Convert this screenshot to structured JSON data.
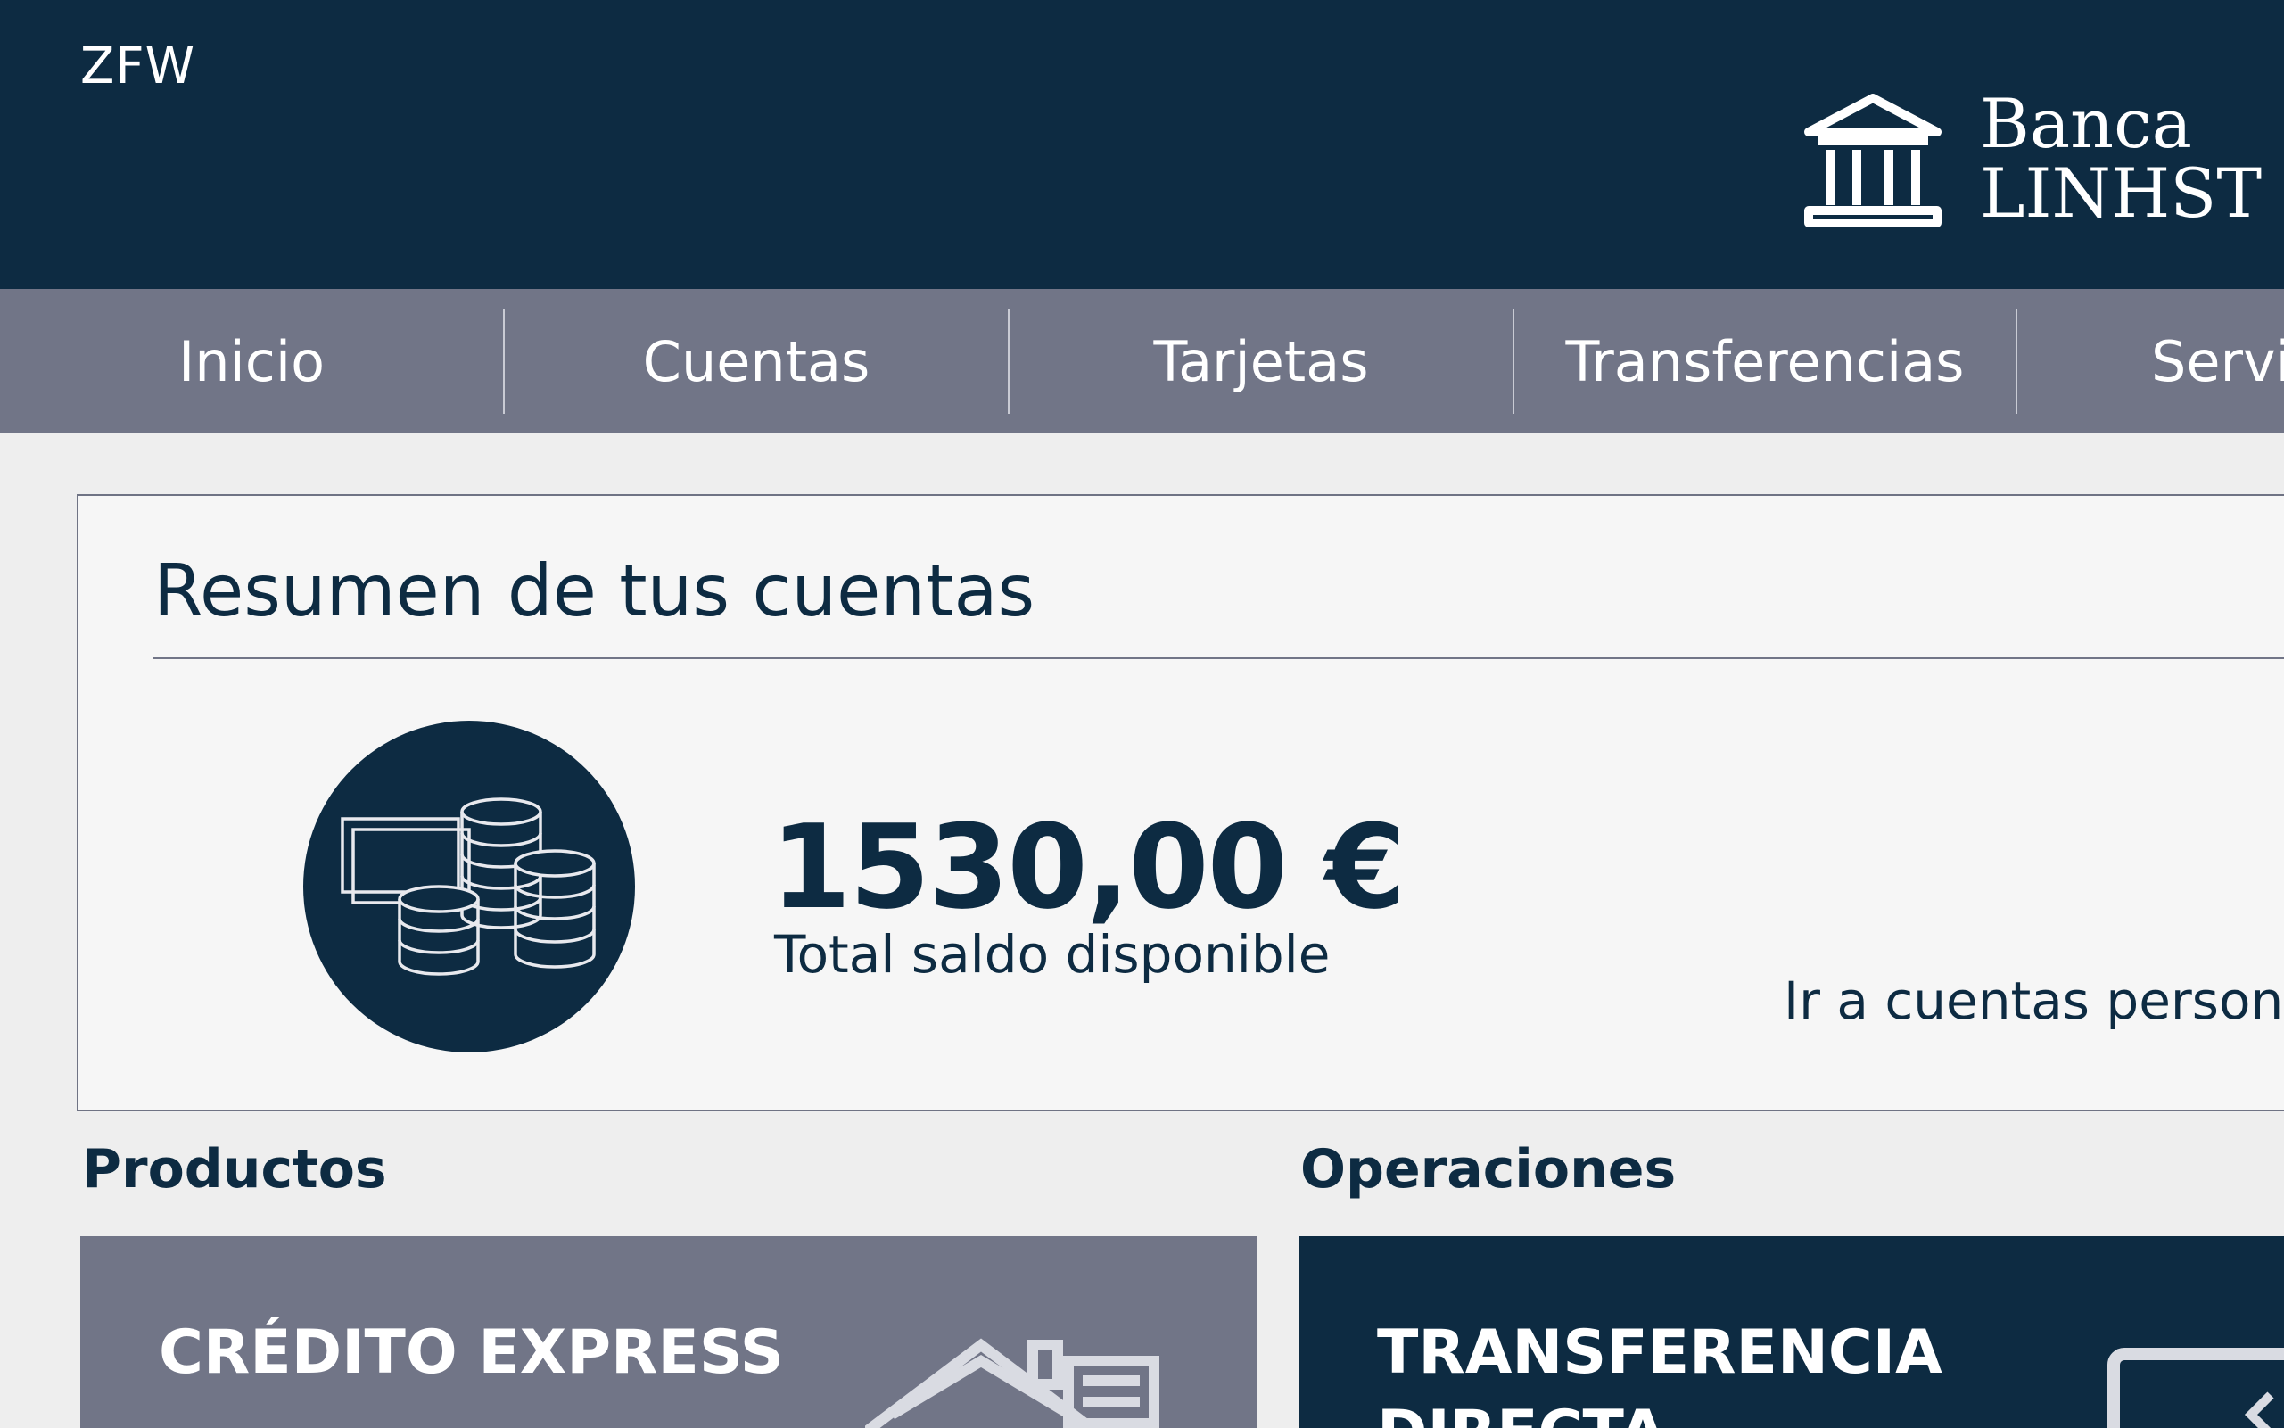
{
  "header": {
    "user_code": "ZFW",
    "logo": {
      "line1": "Banca",
      "line2": "LINHST",
      "icon": "bank-building-icon"
    }
  },
  "nav": {
    "items": [
      {
        "label": "Inicio"
      },
      {
        "label": "Cuentas"
      },
      {
        "label": "Tarjetas"
      },
      {
        "label": "Transferencias"
      },
      {
        "label": "Servi"
      }
    ]
  },
  "summary": {
    "title": "Resumen de tus cuentas",
    "icon": "coins-money-icon",
    "amount": "1530,00 €",
    "amount_label": "Total saldo disponible",
    "link": "Ir a cuentas personal"
  },
  "sections": {
    "products": {
      "title": "Productos",
      "card_title": "CRÉDITO EXPRESS",
      "card_icon": "house-icon"
    },
    "operations": {
      "title": "Operaciones",
      "card_title": "TRANSFERENCIA DIRECTA",
      "card_icon": "laptop-icon"
    }
  },
  "colors": {
    "navy": "#0d2b42",
    "nav_gray": "#717587",
    "background": "#eeeeee",
    "panel": "#f6f6f6"
  }
}
